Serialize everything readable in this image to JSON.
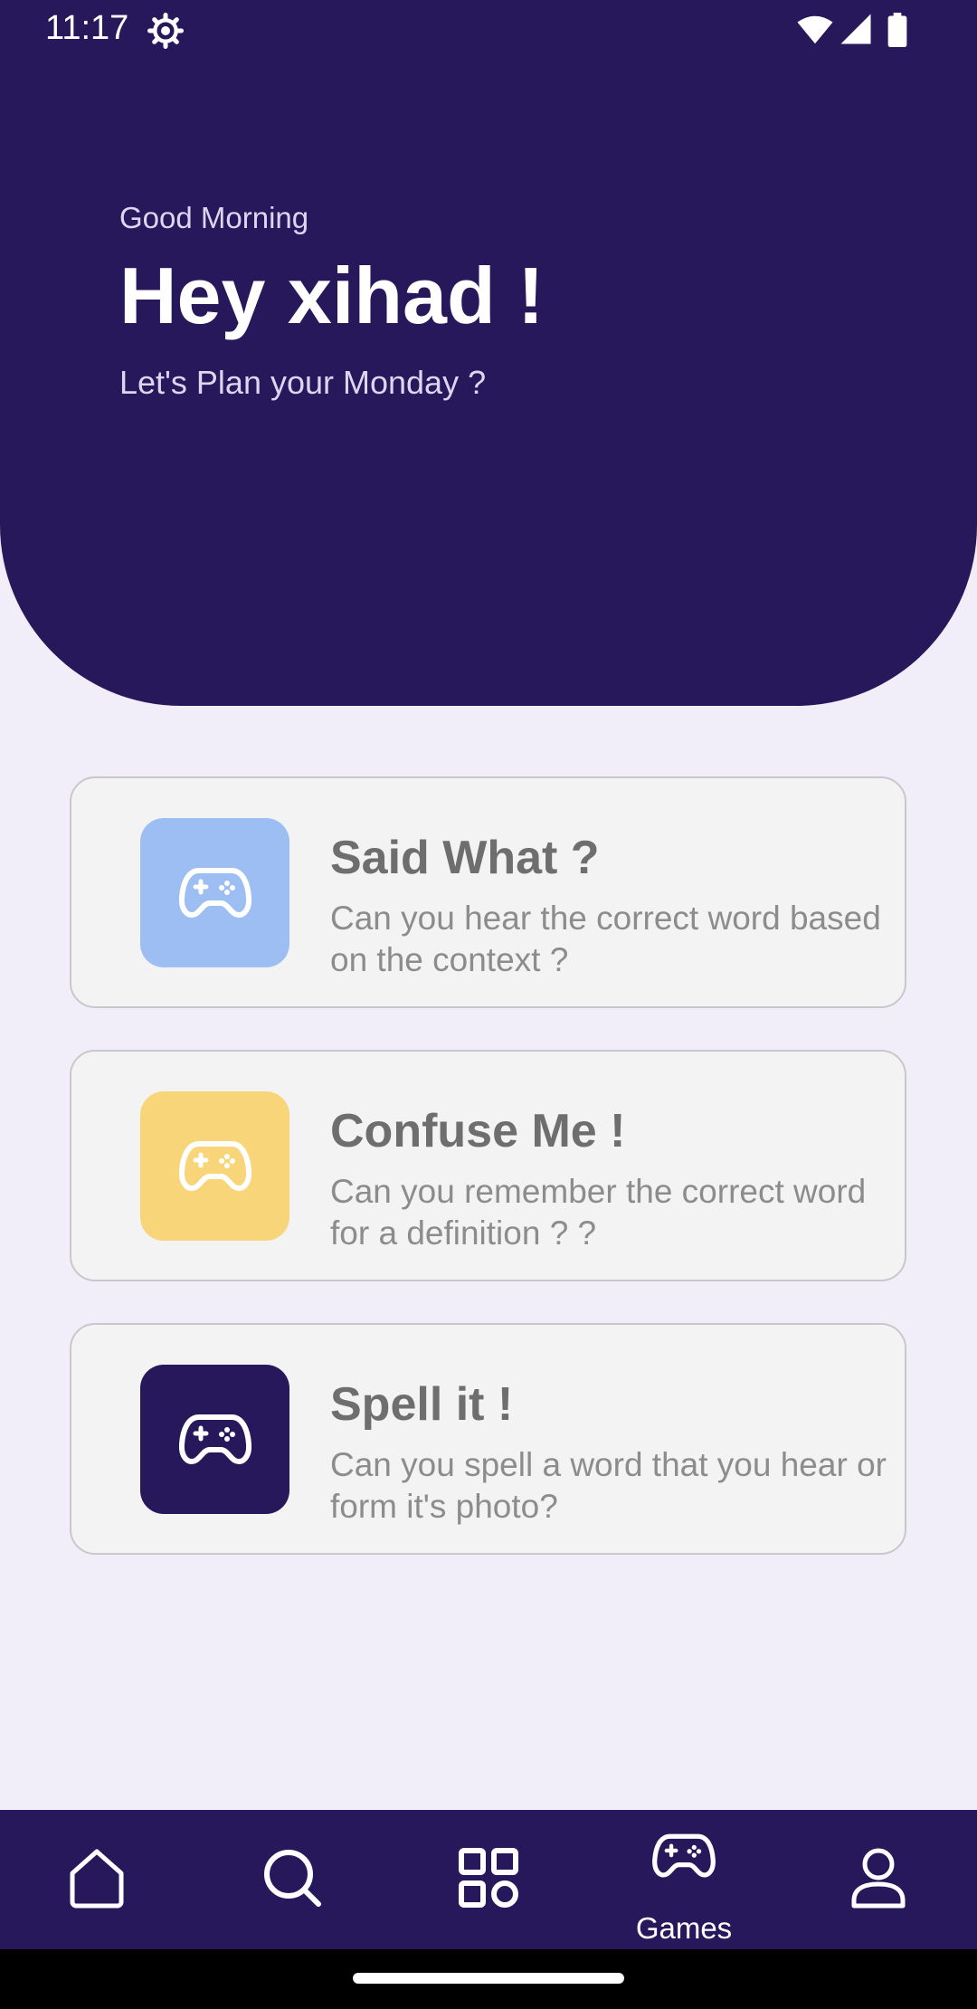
{
  "status_bar": {
    "time": "11:17"
  },
  "header": {
    "greeting": "Good Morning",
    "title": "Hey xihad !",
    "subtitle": "Let's Plan your Monday ?"
  },
  "cards": [
    {
      "title": "Said What ?",
      "description": "Can you hear the correct word based on the context ?",
      "icon": "gamepad-icon",
      "icon_bg": "#9DBEF3"
    },
    {
      "title": "Confuse Me !",
      "description": "Can you remember the correct word for a definition ? ?",
      "icon": "gamepad-icon",
      "icon_bg": "#F9D57A"
    },
    {
      "title": "Spell it !",
      "description": "Can you spell a  word that you hear or form it's photo?",
      "icon": "gamepad-icon",
      "icon_bg": "#26185B"
    }
  ],
  "bottom_nav": {
    "active": "games",
    "games_label": "Games"
  },
  "colors": {
    "primary": "#26185B",
    "background": "#F1EEF9",
    "card_bg": "#F3F3F4"
  }
}
